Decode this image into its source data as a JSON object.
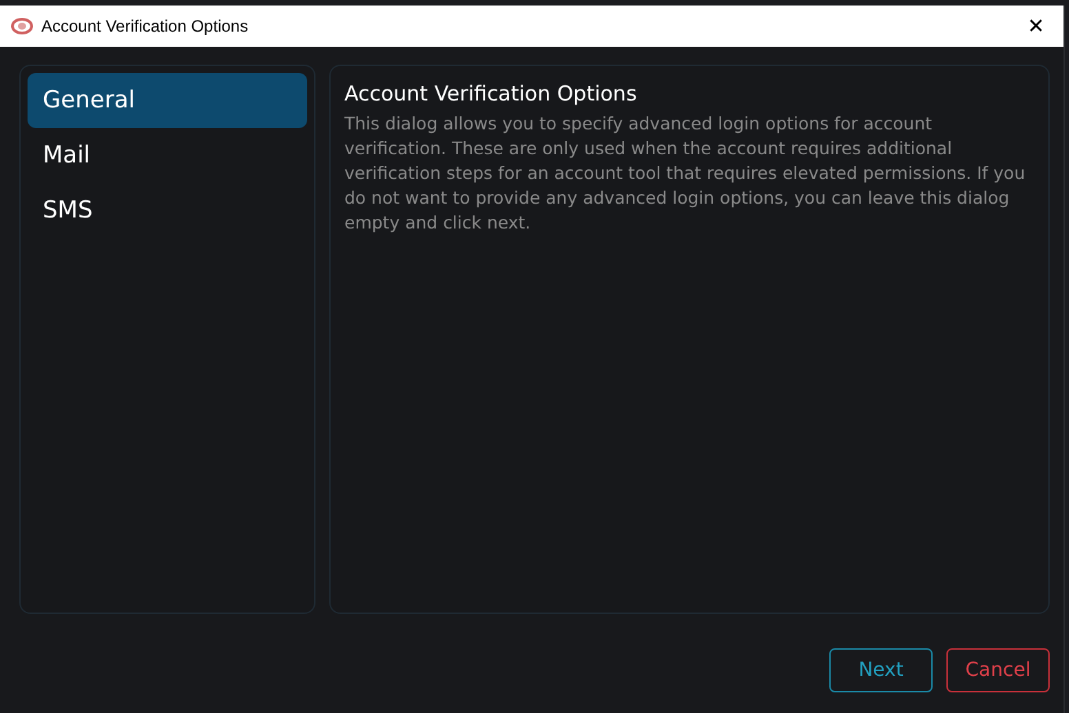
{
  "window": {
    "title": "Account Verification Options",
    "close": "✕"
  },
  "sidebar": {
    "items": [
      {
        "label": "General",
        "selected": true
      },
      {
        "label": "Mail",
        "selected": false
      },
      {
        "label": "SMS",
        "selected": false
      }
    ]
  },
  "content": {
    "heading": "Account Verification Options",
    "description": "This dialog allows you to specify advanced login options for account verification. These are only used when the account requires additional verification steps for an account tool that requires elevated permissions. If you do not want to provide any advanced login options, you can leave this dialog empty and click next."
  },
  "buttons": [
    {
      "label": "Next",
      "kind": "primary"
    },
    {
      "label": "Cancel",
      "kind": "danger"
    }
  ]
}
